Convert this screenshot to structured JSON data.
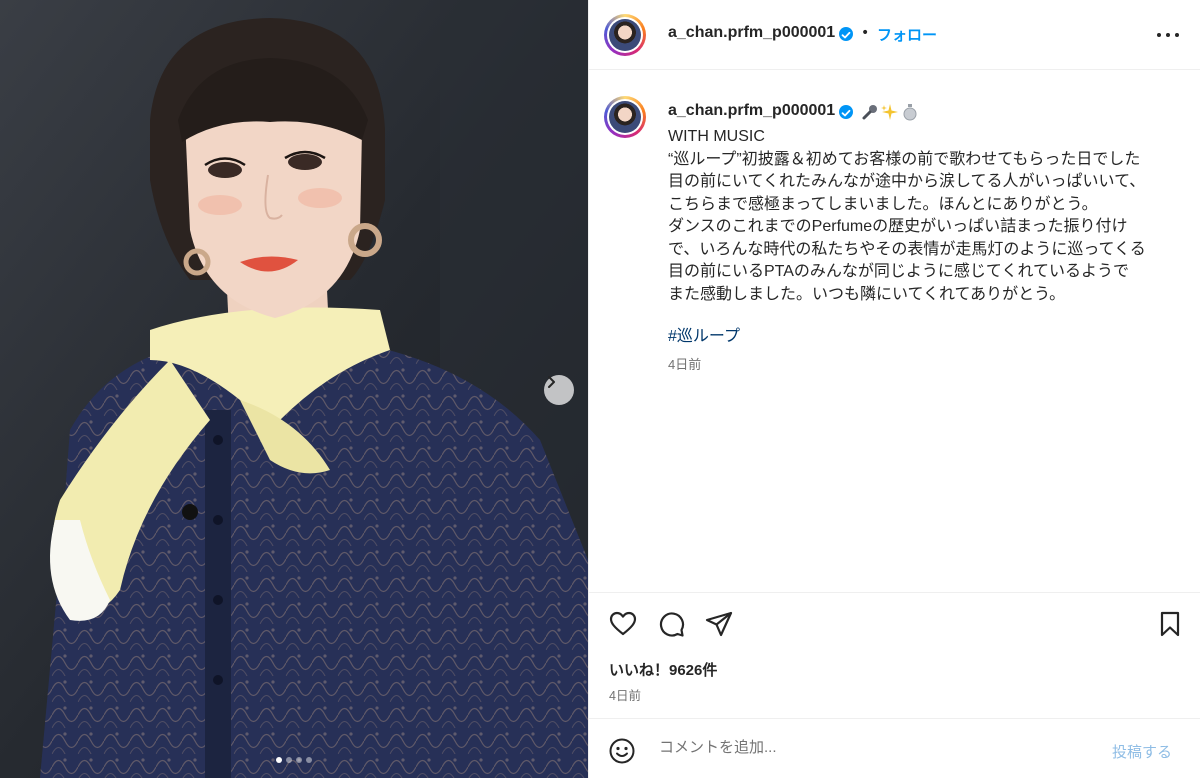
{
  "post": {
    "author": "a_chan.prfm_p000001",
    "follow_label": "フォロー",
    "separator": "•",
    "caption": {
      "lines": [
        "WITH MUSIC",
        "“巡ループ”初披露＆初めてお客様の前で歌わせてもらった日でした",
        "目の前にいてくれたみんなが途中から涙してる人がいっぱいいて、",
        "こちらまで感極まってしまいました。ほんとにありがとう。",
        "ダンスのこれまでのPerfumeの歴史がいっぱい詰まった振り付け",
        "で、いろんな時代の私たちやその表情が走馬灯のように巡ってくる",
        "目の前にいるPTAのみんなが同じように感じてくれているようで",
        "また感動しました。いつも隣にいてくれてありがとう。"
      ],
      "hashtag": "#巡ループ",
      "time": "4日前"
    },
    "caption_emojis": [
      "microphone-icon",
      "sparkles-icon",
      "silver-ball-icon"
    ],
    "likes_label": "いいね！9626件",
    "time": "4日前"
  },
  "carousel": {
    "slide_count": 4,
    "active_index": 0
  },
  "comment_box": {
    "placeholder": "コメントを追加...",
    "post_label": "投稿する"
  },
  "colors": {
    "accent": "#0095f6",
    "hashtag": "#00376b",
    "muted": "#737373",
    "post_disabled": "#8fbde5"
  }
}
